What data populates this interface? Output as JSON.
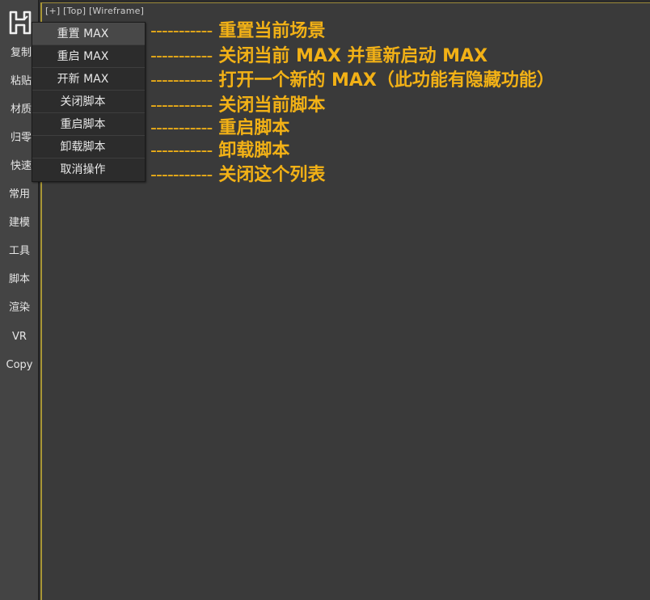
{
  "sidebar": {
    "items": [
      {
        "label": "复制"
      },
      {
        "label": "粘贴"
      },
      {
        "label": "材质"
      },
      {
        "label": "归零"
      },
      {
        "label": "快速"
      },
      {
        "label": "常用"
      },
      {
        "label": "建模"
      },
      {
        "label": "工具"
      },
      {
        "label": "脚本"
      },
      {
        "label": "渲染"
      },
      {
        "label": "VR"
      },
      {
        "label": "Copy"
      }
    ]
  },
  "viewport": {
    "label": "[+] [Top] [Wireframe]"
  },
  "menu": {
    "items": [
      {
        "label": "重置 MAX",
        "selected": true
      },
      {
        "label": "重启 MAX"
      },
      {
        "label": "开新 MAX"
      },
      {
        "label": "关闭脚本"
      },
      {
        "label": "重启脚本"
      },
      {
        "label": "卸载脚本"
      },
      {
        "label": "取消操作"
      }
    ]
  },
  "annotations": [
    {
      "dash": "-----------",
      "text": "重置当前场景"
    },
    {
      "dash": "-----------",
      "text": "关闭当前 MAX 并重新启动 MAX"
    },
    {
      "dash": "-----------",
      "text": "打开一个新的 MAX（此功能有隐藏功能）"
    },
    {
      "dash": "-----------",
      "text": "关闭当前脚本"
    },
    {
      "dash": "-----------",
      "text": "重启脚本"
    },
    {
      "dash": "-----------",
      "text": "卸载脚本"
    },
    {
      "dash": "-----------",
      "text": "关闭这个列表"
    }
  ],
  "colors": {
    "annotation": "#f2b116",
    "viewport_border": "#a89636",
    "sidebar_bg": "#444444",
    "viewport_bg": "#3a3a3a"
  }
}
